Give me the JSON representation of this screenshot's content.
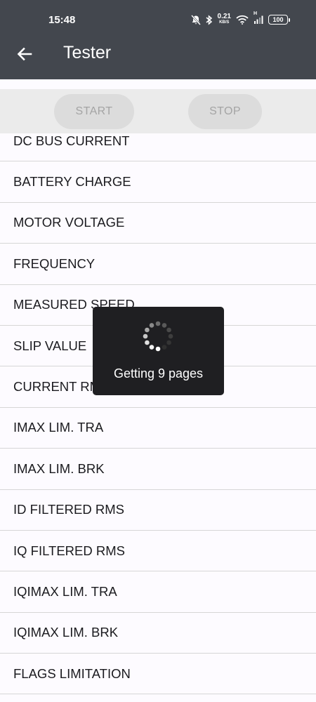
{
  "status_bar": {
    "time": "15:48",
    "net_speed_value": "0.21",
    "net_speed_unit": "KB/S",
    "signal_label": "H",
    "battery": "100",
    "icons": [
      "mute-bell-icon",
      "bluetooth-icon",
      "wifi-icon",
      "signal-icon",
      "battery-icon"
    ]
  },
  "app_bar": {
    "title": "Tester",
    "back_icon": "arrow-left-icon"
  },
  "controls": {
    "start_label": "START",
    "stop_label": "STOP"
  },
  "list": {
    "items": [
      "DC BUS CURRENT",
      "BATTERY CHARGE",
      "MOTOR VOLTAGE",
      "FREQUENCY",
      "MEASURED SPEED",
      "SLIP VALUE",
      "CURRENT RMS",
      "IMAX LIM. TRA",
      "IMAX LIM. BRK",
      "ID FILTERED RMS",
      "IQ FILTERED RMS",
      "IQIMAX LIM. TRA",
      "IQIMAX LIM. BRK",
      "FLAGS LIMITATION"
    ]
  },
  "loading": {
    "message": "Getting 9 pages",
    "icon": "spinner-icon"
  },
  "colors": {
    "app_bar": "#43474e",
    "controls_bg": "#ebebeb",
    "button_bg": "#dcdcdc",
    "button_text": "#a4a4a4",
    "toast_bg": "#1f1f22"
  }
}
